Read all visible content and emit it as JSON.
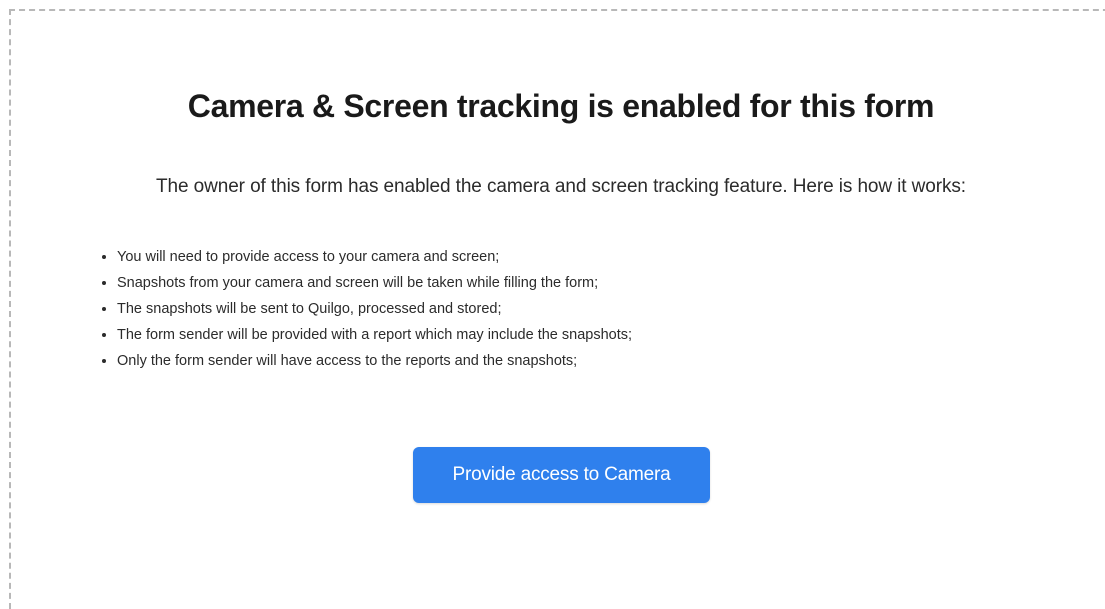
{
  "heading": "Camera & Screen tracking is enabled for this form",
  "intro": "The owner of this form has enabled the camera and screen tracking feature. Here is how it works:",
  "bullets": [
    "You will need to provide access to your camera and screen;",
    "Snapshots from your camera and screen will be taken while filling the form;",
    "The snapshots will be sent to Quilgo, processed and stored;",
    "The form sender will be provided with a report which may include the snapshots;",
    "Only the form sender will have access to the reports and the snapshots;"
  ],
  "cta": {
    "label": "Provide access to Camera",
    "color": "#2f80ed"
  }
}
